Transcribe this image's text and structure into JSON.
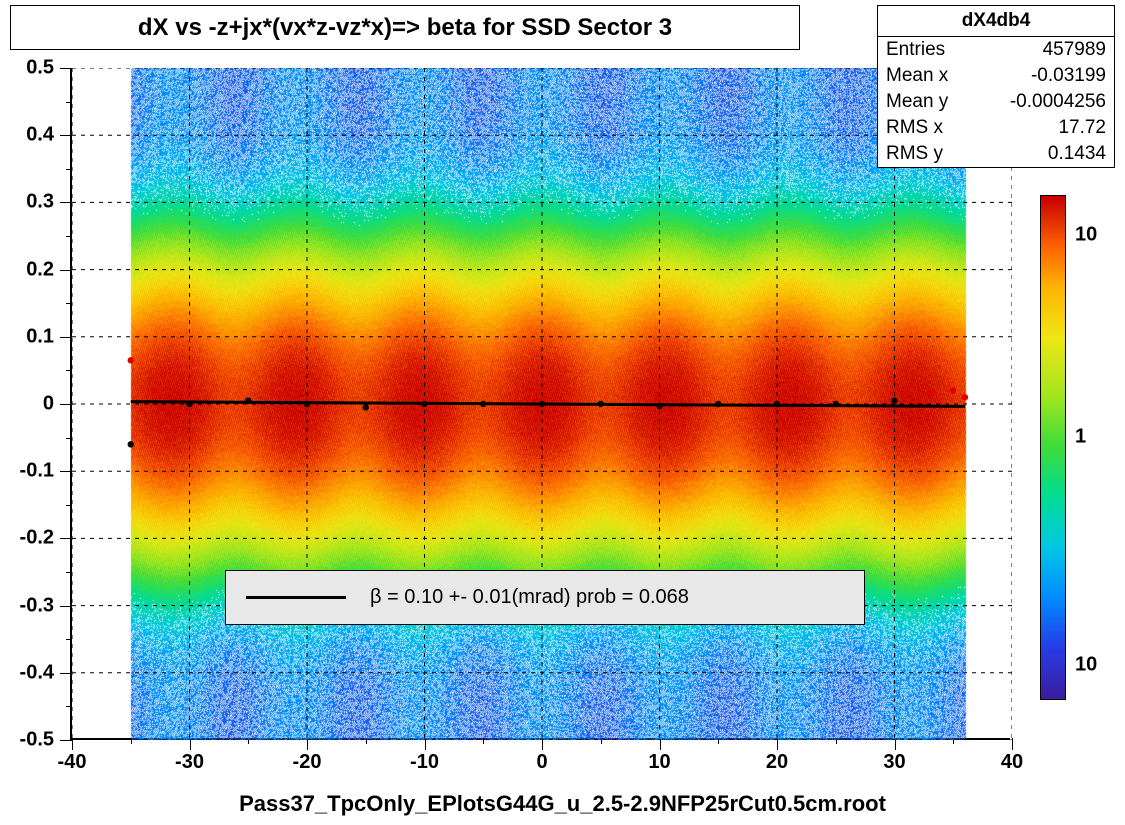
{
  "title": "dX vs  -z+jx*(vx*z-vz*x)=> beta  for SSD Sector 3",
  "stats": {
    "name": "dX4db4",
    "entries_label": "Entries",
    "entries": "457989",
    "meanx_label": "Mean x",
    "meanx": "-0.03199",
    "meany_label": "Mean y",
    "meany": "-0.0004256",
    "rmsx_label": "RMS x",
    "rmsx": "17.72",
    "rmsy_label": "RMS y",
    "rmsy": "0.1434"
  },
  "legend": {
    "text": "β =      0.10 +-     0.01(mrad) prob = 0.068"
  },
  "caption": "Pass37_TpcOnly_EPlotsG44G_u_2.5-2.9NFP25rCut0.5cm.root",
  "axes": {
    "x": {
      "min": -40,
      "max": 40,
      "step": 10,
      "sub": 5
    },
    "y": {
      "min": -0.5,
      "max": 0.5,
      "step": 0.1,
      "sub": 0.05
    }
  },
  "palette_labels": [
    {
      "v": "10",
      "frac": 0.92
    },
    {
      "v": "1",
      "frac": 0.52
    },
    {
      "v": "10",
      "frac": 0.07
    }
  ],
  "chart_data": {
    "type": "heatmap",
    "xlabel": "",
    "ylabel": "",
    "xlim": [
      -40,
      40
    ],
    "ylim": [
      -0.5,
      0.5
    ],
    "z_scale": "log",
    "zlim_approx": [
      0.1,
      30
    ],
    "description": "2D histogram of dX (y) vs -z+jx*(vx*z-vz*x) (x). Density is broadly uniform in x over [-35,35] but sharply peaked around y=0; the central band |y|<0.05 reaches the highest z (orange/red), falling through yellow/green toward the y edges. Outside |x|>35 the histogram is empty.",
    "density_profile_vs_y": [
      {
        "y": -0.45,
        "z": 0.4
      },
      {
        "y": -0.3,
        "z": 0.8
      },
      {
        "y": -0.2,
        "z": 1.5
      },
      {
        "y": -0.1,
        "z": 4
      },
      {
        "y": -0.05,
        "z": 10
      },
      {
        "y": -0.02,
        "z": 22
      },
      {
        "y": 0.0,
        "z": 28
      },
      {
        "y": 0.02,
        "z": 22
      },
      {
        "y": 0.05,
        "z": 10
      },
      {
        "y": 0.1,
        "z": 4
      },
      {
        "y": 0.2,
        "z": 1.5
      },
      {
        "y": 0.3,
        "z": 0.8
      },
      {
        "y": 0.45,
        "z": 0.4
      }
    ],
    "x_data_extent": [
      -35,
      36
    ],
    "fit": {
      "name": "beta",
      "value_mrad": 0.1,
      "err_mrad": 0.01,
      "prob": 0.068,
      "line": {
        "x": [
          -35,
          36
        ],
        "y": [
          0.0035,
          -0.0036
        ]
      }
    },
    "profile_points_approx": [
      {
        "x": -35,
        "y": 0.065,
        "color": "red"
      },
      {
        "x": -35,
        "y": -0.06,
        "color": "black"
      },
      {
        "x": -33,
        "y": 0.02,
        "color": "red"
      },
      {
        "x": -30,
        "y": 0.0,
        "color": "black"
      },
      {
        "x": -25,
        "y": 0.005,
        "color": "black"
      },
      {
        "x": -20,
        "y": 0.0,
        "color": "black"
      },
      {
        "x": -15,
        "y": -0.005,
        "color": "black"
      },
      {
        "x": -10,
        "y": 0.0,
        "color": "black"
      },
      {
        "x": -5,
        "y": 0.0,
        "color": "black"
      },
      {
        "x": 0,
        "y": 0.0,
        "color": "black"
      },
      {
        "x": 5,
        "y": 0.0,
        "color": "black"
      },
      {
        "x": 10,
        "y": -0.003,
        "color": "black"
      },
      {
        "x": 15,
        "y": 0.0,
        "color": "black"
      },
      {
        "x": 20,
        "y": 0.0,
        "color": "black"
      },
      {
        "x": 25,
        "y": 0.0,
        "color": "black"
      },
      {
        "x": 30,
        "y": 0.005,
        "color": "black"
      },
      {
        "x": 33,
        "y": 0.015,
        "color": "red"
      },
      {
        "x": 35,
        "y": 0.02,
        "color": "red"
      },
      {
        "x": 36,
        "y": 0.01,
        "color": "red"
      }
    ]
  }
}
